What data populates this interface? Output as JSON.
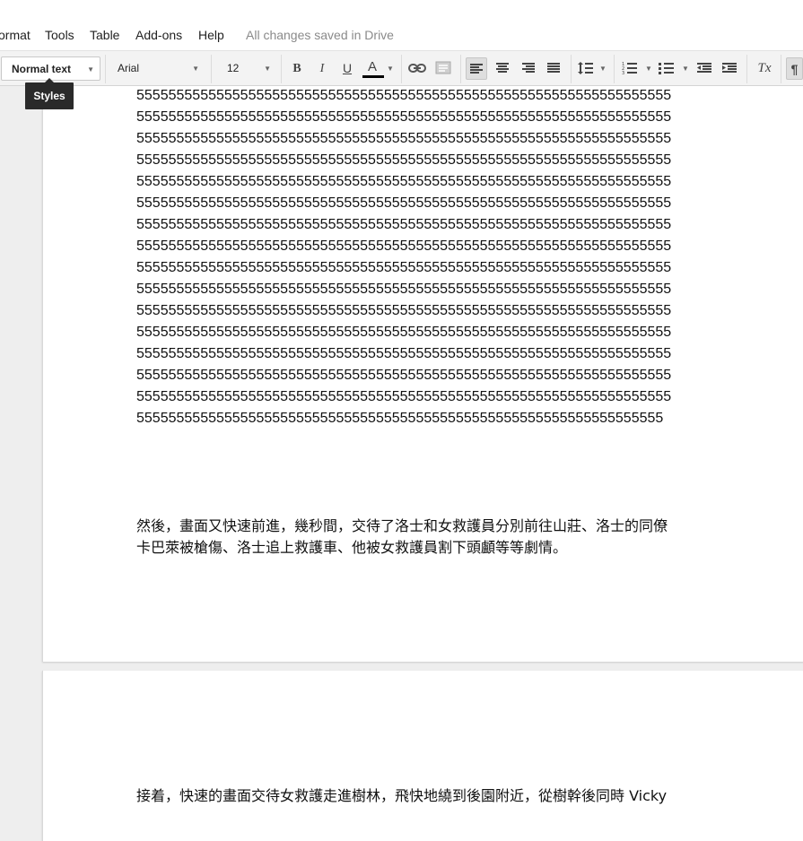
{
  "menu": {
    "items": [
      "ormat",
      "Tools",
      "Table",
      "Add-ons",
      "Help"
    ],
    "save_status": "All changes saved in Drive"
  },
  "toolbar": {
    "style_value": "Normal text",
    "font_value": "Arial",
    "size_value": "12",
    "bold_label": "B",
    "italic_label": "I",
    "underline_label": "U",
    "text_color_label": "A",
    "text_color": "#000000",
    "clear_format_label": "Tx",
    "paragraph_label": "¶"
  },
  "tooltip": {
    "text": "Styles"
  },
  "document": {
    "number_lines": [
      "5555555555555555555555555555555555555555555555555555555555555555555",
      "5555555555555555555555555555555555555555555555555555555555555555555",
      "5555555555555555555555555555555555555555555555555555555555555555555",
      "5555555555555555555555555555555555555555555555555555555555555555555",
      "5555555555555555555555555555555555555555555555555555555555555555555",
      "5555555555555555555555555555555555555555555555555555555555555555555",
      "5555555555555555555555555555555555555555555555555555555555555555555",
      "5555555555555555555555555555555555555555555555555555555555555555555",
      "5555555555555555555555555555555555555555555555555555555555555555555",
      "5555555555555555555555555555555555555555555555555555555555555555555",
      "5555555555555555555555555555555555555555555555555555555555555555555",
      "5555555555555555555555555555555555555555555555555555555555555555555",
      "5555555555555555555555555555555555555555555555555555555555555555555",
      "5555555555555555555555555555555555555555555555555555555555555555555",
      "5555555555555555555555555555555555555555555555555555555555555555555",
      "555555555555555555555555555555555555555555555555555555555555555555"
    ],
    "para1_line1": "然後，畫面又快速前進，幾秒間，交待了洛士和女救護員分別前往山莊、洛士的同僚",
    "para1_line2": "卡巴萊被槍傷、洛士追上救護車、他被女救護員割下頭顱等等劇情。",
    "para2_line1": "接着，快速的畫面交待女救護走進樹林，飛快地繞到後園附近，從樹幹後同時 Vicky"
  }
}
